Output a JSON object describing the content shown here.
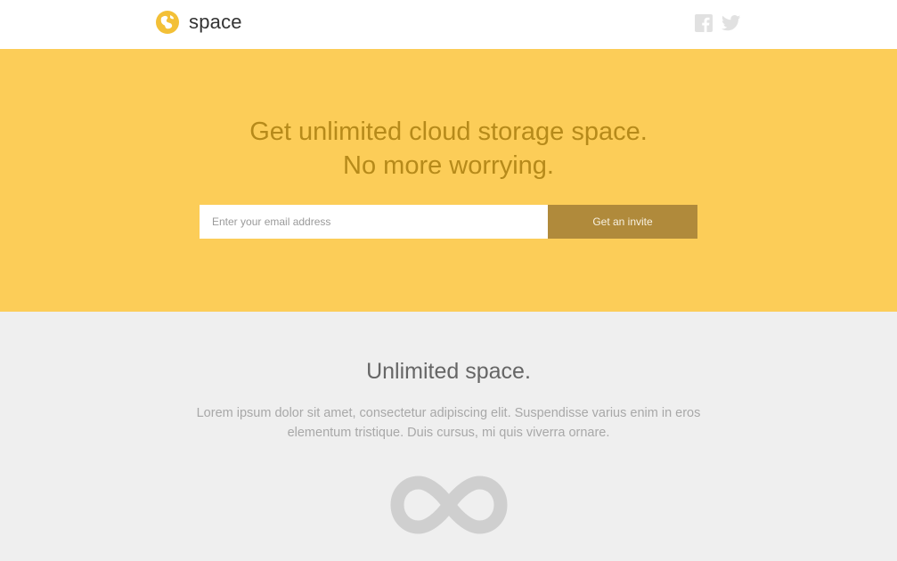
{
  "header": {
    "brand": "space",
    "logo_icon": "globe-icon",
    "social": [
      {
        "name": "facebook",
        "icon": "facebook-icon"
      },
      {
        "name": "twitter",
        "icon": "twitter-icon"
      }
    ]
  },
  "hero": {
    "title_line1": "Get unlimited cloud storage space.",
    "title_line2": "No more worrying.",
    "email_placeholder": "Enter your email address",
    "email_value": "",
    "button_label": "Get an invite",
    "colors": {
      "background": "#fccd58",
      "text": "#b68a1a",
      "button": "#b08a3b"
    }
  },
  "feature": {
    "title": "Unlimited space.",
    "description": "Lorem ipsum dolor sit amet, consectetur adipiscing elit. Suspendisse varius enim in eros elementum tristique. Duis cursus, mi quis viverra ornare.",
    "icon": "infinity-icon"
  }
}
